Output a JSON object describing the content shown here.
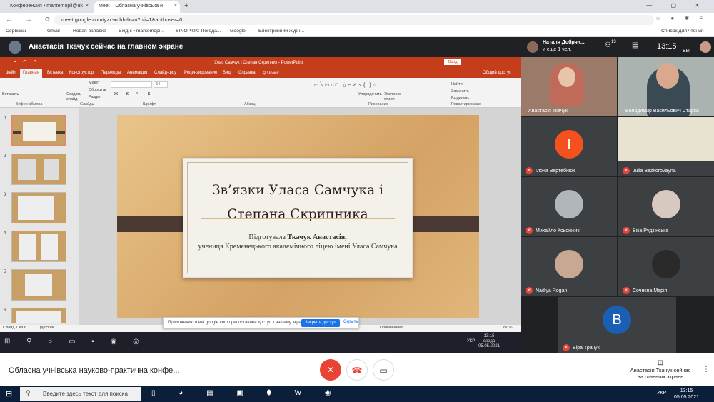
{
  "browser": {
    "tabs": [
      {
        "label": "Конференция • mantemopii@uk",
        "close": "×"
      },
      {
        "label": "Meet – Обласна учнівська н",
        "close": "×"
      }
    ],
    "new_tab": "+",
    "url": "meet.google.com/yzx-xuhh-bsm?pli=1&authuser=0",
    "bookmarks": [
      "Сервисы",
      "Gmail",
      "Новая вкладка",
      "Вхідні • mantemopi...",
      "SINOPTIK: Погода...",
      "Google",
      "Електронний журн..."
    ],
    "reading_list": "Список для чтения"
  },
  "meet": {
    "presenting_banner": "Анастасія Ткачук сейчас на главном экране",
    "top_user": "Наталя Добрян...",
    "top_more": "и еще 1 чел.",
    "people_count": "13",
    "time": "13:15",
    "you_label": "Вы",
    "meeting_title": "Обласна учнівська науково-практична конфе...",
    "presenter_info": "Анастасія Ткачук сейчас на главном экране",
    "participants": [
      {
        "name": "Анастасія Ткачук",
        "kind": "video"
      },
      {
        "name": "Володимир Васильович Старка",
        "kind": "video"
      },
      {
        "name": "Ілона Вертебнюк",
        "kind": "letter",
        "letter": "І",
        "color": "#f4511e"
      },
      {
        "name": "Julia Bezkorovayna",
        "kind": "image"
      },
      {
        "name": "Михайло Ксьонжик",
        "kind": "avatar"
      },
      {
        "name": "Віка Рудзінська",
        "kind": "avatar"
      },
      {
        "name": "Nadiya Rogan",
        "kind": "avatar"
      },
      {
        "name": "Сочнєва Марія",
        "kind": "avatar"
      },
      {
        "name": "Віра Трачук",
        "kind": "letter",
        "letter": "B",
        "color": "#1a5fb4"
      }
    ]
  },
  "ppt": {
    "window_title": "Улас Самчук і Степан Скрипник  -  PowerPoint",
    "signin": "Вход",
    "tabs": [
      "Файл",
      "Главная",
      "Вставка",
      "Конструктор",
      "Переходы",
      "Анимация",
      "Слайд-шоу",
      "Рецензирование",
      "Вид",
      "Справка",
      "Поиск"
    ],
    "share": "Общий доступ",
    "groups": [
      "Буфер обмена",
      "Слайды",
      "Шрифт",
      "Абзац",
      "Рисование",
      "Редактирование"
    ],
    "ribbon_buttons": [
      "Вставить",
      "Создать слайд",
      "Макет",
      "Сбросить",
      "Раздел",
      "Упорядочить",
      "Экспресс-стили",
      "Найти",
      "Заменить",
      "Выделить"
    ],
    "font_size": "54",
    "slide": {
      "title_line1": "Зв’язки Уласа Самчука і",
      "title_line2": "Степана Скрипника",
      "prepared_label": "Підготувала ",
      "author": "Ткачук Анастасія,",
      "affiliation": "учениця Кременецького академічного ліцею імені Уласа Самчука"
    },
    "thumb_numbers": [
      "1",
      "2",
      "3",
      "4",
      "5",
      "6"
    ],
    "status": {
      "slide": "Слайд 1 из 6",
      "lang": "русский",
      "notes": "Примечания",
      "zoom": "87 %"
    },
    "notification": {
      "text": "Приложению meet.google.com предоставлен доступ к вашему экрану.",
      "share_btn": "Закрыть доступ",
      "hide": "Скрыть"
    },
    "inner_clock": {
      "time": "13:15",
      "day": "среда",
      "date": "05.05.2021"
    }
  },
  "taskbar": {
    "search_placeholder": "Введите здесь текст для поиска",
    "lang": "УКР",
    "time": "13:15",
    "date": "05.05.2021"
  }
}
